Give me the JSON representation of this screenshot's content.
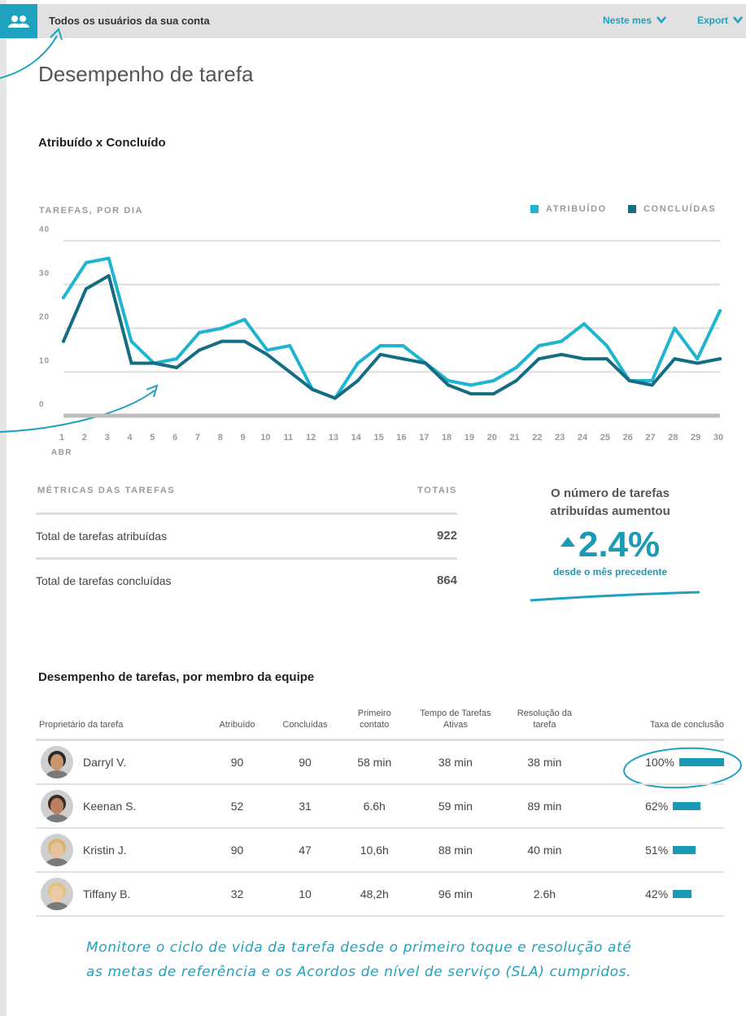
{
  "header": {
    "title": "Todos os usuários da sua conta",
    "period_label": "Neste mes",
    "export_label": "Export"
  },
  "page_title": "Desempenho de tarefa",
  "chart_section_title": "Atribuído x Concluído",
  "chart_data": {
    "type": "line",
    "title": "",
    "ylabel": "TAREFAS, POR DIA",
    "xlabel": "",
    "x_sublabel": "ABR",
    "ylim": [
      0,
      40
    ],
    "yticks": [
      "40",
      "30",
      "20",
      "10",
      "0"
    ],
    "x": [
      "1",
      "2",
      "3",
      "4",
      "5",
      "6",
      "7",
      "8",
      "9",
      "10",
      "11",
      "12",
      "13",
      "14",
      "15",
      "16",
      "17",
      "18",
      "19",
      "20",
      "21",
      "22",
      "23",
      "24",
      "25",
      "26",
      "27",
      "28",
      "29",
      "30"
    ],
    "series": [
      {
        "name": "ATRIBUÍDO",
        "color": "#1fb5d0",
        "values": [
          27,
          35,
          36,
          17,
          12,
          13,
          19,
          20,
          22,
          15,
          16,
          6,
          4,
          12,
          16,
          16,
          12,
          8,
          7,
          8,
          11,
          16,
          17,
          21,
          16,
          8,
          8,
          20,
          13,
          24
        ]
      },
      {
        "name": "CONCLUÍDAS",
        "color": "#146d82",
        "values": [
          17,
          29,
          32,
          12,
          12,
          11,
          15,
          17,
          17,
          14,
          10,
          6,
          4,
          8,
          14,
          13,
          12,
          7,
          5,
          5,
          8,
          13,
          14,
          13,
          13,
          8,
          7,
          13,
          12,
          13
        ]
      }
    ],
    "grid": true,
    "legend": "top-right"
  },
  "metrics": {
    "header": "MÉTRICAS DAS TAREFAS",
    "totals_header": "TOTAIS",
    "rows": [
      {
        "label": "Total de tarefas atribuídas",
        "value": "922"
      },
      {
        "label": "Total de tarefas concluídas",
        "value": "864"
      }
    ]
  },
  "callout": {
    "headline_1": "O número de tarefas",
    "headline_2": "atribuídas aumentou",
    "value": "2.4%",
    "sub": "desde o mês precedente"
  },
  "team_section_title": "Desempenho de tarefas, por membro da equipe",
  "team_table": {
    "columns": [
      "Proprietário da tarefa",
      "Atribuído",
      "Concluídas",
      "Primeiro contato",
      "Tempo de Tarefas Ativas",
      "Resolução da tarefa",
      "Taxa de conclusão"
    ],
    "rows": [
      {
        "name": "Darryl V.",
        "assigned": "90",
        "completed": "90",
        "first_contact": "58 min",
        "active_time": "38 min",
        "resolution": "38 min",
        "rate": "100%",
        "rate_value": 1.0
      },
      {
        "name": "Keenan S.",
        "assigned": "52",
        "completed": "31",
        "first_contact": "6.6h",
        "active_time": "59 min",
        "resolution": "89 min",
        "rate": "62%",
        "rate_value": 0.62
      },
      {
        "name": "Kristin J.",
        "assigned": "90",
        "completed": "47",
        "first_contact": "10,6h",
        "active_time": "88 min",
        "resolution": "40 min",
        "rate": "51%",
        "rate_value": 0.51
      },
      {
        "name": "Tiffany B.",
        "assigned": "32",
        "completed": "10",
        "first_contact": "48,2h",
        "active_time": "96 min",
        "resolution": "2.6h",
        "rate": "42%",
        "rate_value": 0.42
      }
    ]
  },
  "note": {
    "line1": "Monitore o ciclo de vida da tarefa desde o primeiro toque e resolução até",
    "line2": "as metas de referência e os Acordos de nível de serviço (SLA) cumpridos."
  },
  "colors": {
    "accent": "#1fa2bf",
    "dark_series": "#146d82",
    "light_series": "#1fb5d0"
  },
  "icons": {
    "users": "users-icon",
    "chevron": "chevron-down-icon"
  }
}
